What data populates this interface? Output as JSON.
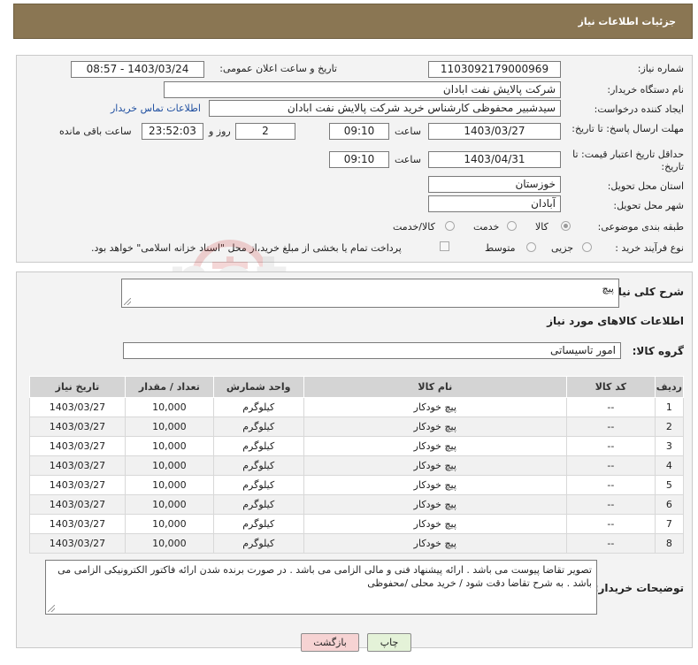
{
  "page_title": "جزئیات اطلاعات نیاز",
  "labels": {
    "need_number": "شماره نیاز:",
    "announce_datetime": "تاریخ و ساعت اعلان عمومی:",
    "buyer_org": "نام دستگاه خریدار:",
    "requester": "ایجاد کننده درخواست:",
    "reply_deadline": "مهلت ارسال پاسخ: تا تاریخ:",
    "price_validity": "حداقل تاریخ اعتبار قیمت: تا تاریخ:",
    "time": "ساعت",
    "day_and": "روز و",
    "remaining": "ساعت باقی مانده",
    "province": "استان محل تحویل:",
    "city": "شهر محل تحویل:",
    "category": "طبقه بندی موضوعی:",
    "purchase_type": "نوع فرآیند خرید :",
    "summary": "شرح کلی نیاز:",
    "goods_info": "اطلاعات کالاهای مورد نیاز",
    "goods_group": "گروه کالا:",
    "buyer_notes": "توضیحات خریدار:"
  },
  "fields": {
    "need_number": "1103092179000969",
    "announce_datetime": "1403/03/24 - 08:57",
    "buyer_org": "شرکت پالایش نفت ابادان",
    "requester": "سیدشبیر محفوظی کارشناس خرید  شرکت پالایش نفت ابادان",
    "contact_link": "اطلاعات تماس خریدار",
    "reply_date": "1403/03/27",
    "reply_time": "09:10",
    "days": "2",
    "remaining_time": "23:52:03",
    "validity_date": "1403/04/31",
    "validity_time": "09:10",
    "province": "خوزستان",
    "city": "آبادان",
    "summary": "پیچ",
    "goods_group": "امور تاسیساتی",
    "buyer_notes": "تصویر تقاضا پیوست می باشد . ارائه پیشنهاد فنی و مالی الزامی می باشد . در صورت برنده شدن ارائه فاکتور الکترونیکی الزامی می باشد . به شرح تقاضا دقت شود  /  خرید محلی /محفوظی"
  },
  "category_options": [
    {
      "label": "کالا",
      "selected": true
    },
    {
      "label": "خدمت",
      "selected": false
    },
    {
      "label": "کالا/خدمت",
      "selected": false
    }
  ],
  "purchase_options": [
    {
      "label": "جزیی",
      "selected": false
    },
    {
      "label": "متوسط",
      "selected": false
    }
  ],
  "payment_note": "پرداخت تمام یا بخشی از مبلغ خرید،از محل \"اسناد خزانه اسلامی\" خواهد بود.",
  "table": {
    "headers": [
      "ردیف",
      "کد کالا",
      "نام کالا",
      "واحد شمارش",
      "تعداد / مقدار",
      "تاریخ نیاز"
    ],
    "rows": [
      [
        "1",
        "--",
        "پیچ خودکار",
        "کیلوگرم",
        "10,000",
        "1403/03/27"
      ],
      [
        "2",
        "--",
        "پیچ خودکار",
        "کیلوگرم",
        "10,000",
        "1403/03/27"
      ],
      [
        "3",
        "--",
        "پیچ خودکار",
        "کیلوگرم",
        "10,000",
        "1403/03/27"
      ],
      [
        "4",
        "--",
        "پیچ خودکار",
        "کیلوگرم",
        "10,000",
        "1403/03/27"
      ],
      [
        "5",
        "--",
        "پیچ خودکار",
        "کیلوگرم",
        "10,000",
        "1403/03/27"
      ],
      [
        "6",
        "--",
        "پیچ خودکار",
        "کیلوگرم",
        "10,000",
        "1403/03/27"
      ],
      [
        "7",
        "--",
        "پیچ خودکار",
        "کیلوگرم",
        "10,000",
        "1403/03/27"
      ],
      [
        "8",
        "--",
        "پیچ خودکار",
        "کیلوگرم",
        "10,000",
        "1403/03/27"
      ]
    ]
  },
  "buttons": {
    "print": "چاپ",
    "back": "بازگشت"
  },
  "watermark_text": "AriaTender.net",
  "colors": {
    "title_bar": "#8a7653",
    "link": "#1f4fa0",
    "back_button": "#f6d3d3",
    "print_button": "#e4f2d8"
  }
}
